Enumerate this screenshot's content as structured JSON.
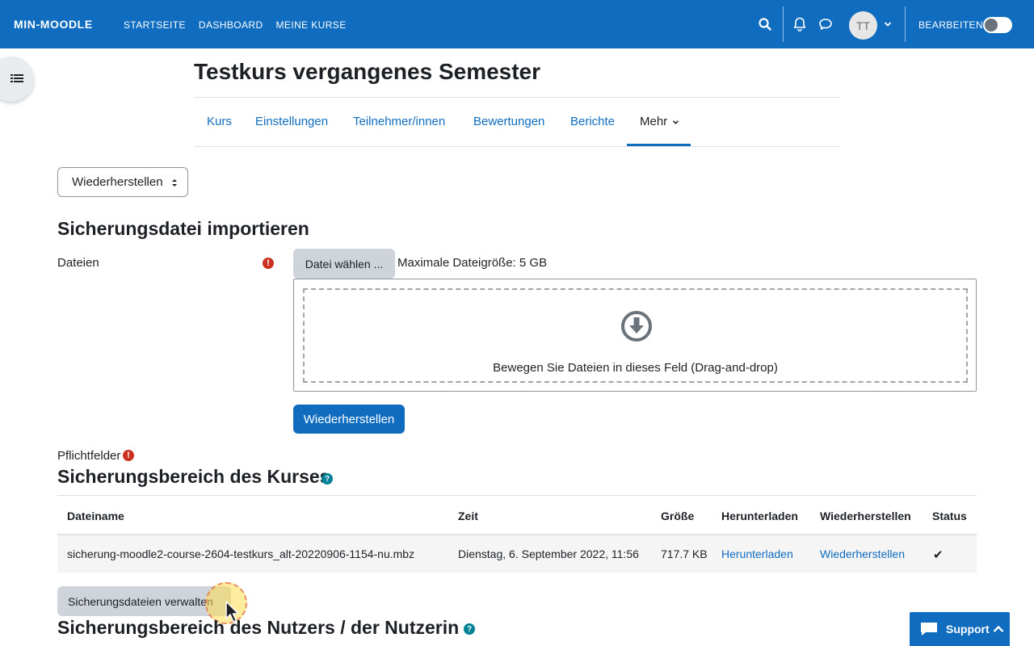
{
  "navbar": {
    "brand": "MIN-MOODLE",
    "links": [
      "STARTSEITE",
      "DASHBOARD",
      "MEINE KURSE"
    ],
    "avatar_initials": "TT",
    "edit_label": "BEARBEITEN",
    "edit_mode_on": false,
    "icons": [
      "search-icon",
      "bell-icon",
      "chat-icon",
      "chevron-down-icon"
    ]
  },
  "header": {
    "title": "Testkurs vergangenes Semester",
    "tabs": [
      "Kurs",
      "Einstellungen",
      "Teilnehmer/innen",
      "Bewertungen",
      "Berichte",
      "Mehr"
    ],
    "active_tab": "Mehr"
  },
  "action_select": {
    "selected": "Wiederherstellen"
  },
  "import_section": {
    "title": "Sicherungsdatei importieren",
    "files_label": "Dateien",
    "choose_button": "Datei wählen ...",
    "max_size": "Maximale Dateigröße: 5 GB",
    "dropzone_text": "Bewegen Sie Dateien in dieses Feld (Drag-and-drop)",
    "restore_button": "Wiederherstellen",
    "required_note": "Pflichtfelder"
  },
  "course_backup": {
    "title": "Sicherungsbereich des Kurses",
    "columns": [
      "Dateiname",
      "Zeit",
      "Größe",
      "Herunterladen",
      "Wiederherstellen",
      "Status"
    ],
    "rows": [
      {
        "filename": "sicherung-moodle2-course-2604-testkurs_alt-20220906-1154-nu.mbz",
        "time": "Dienstag, 6. September 2022, 11:56",
        "size": "717.7 KB",
        "download": "Herunterladen",
        "restore": "Wiederherstellen",
        "status": "✔"
      }
    ],
    "manage_button": "Sicherungsdateien verwalten"
  },
  "user_backup": {
    "title": "Sicherungsbereich des Nutzers / der Nutzerin"
  },
  "support": {
    "label": "Support"
  },
  "colors": {
    "brand": "#0f6cbf",
    "required": "#ca3120",
    "help": "#008196"
  }
}
